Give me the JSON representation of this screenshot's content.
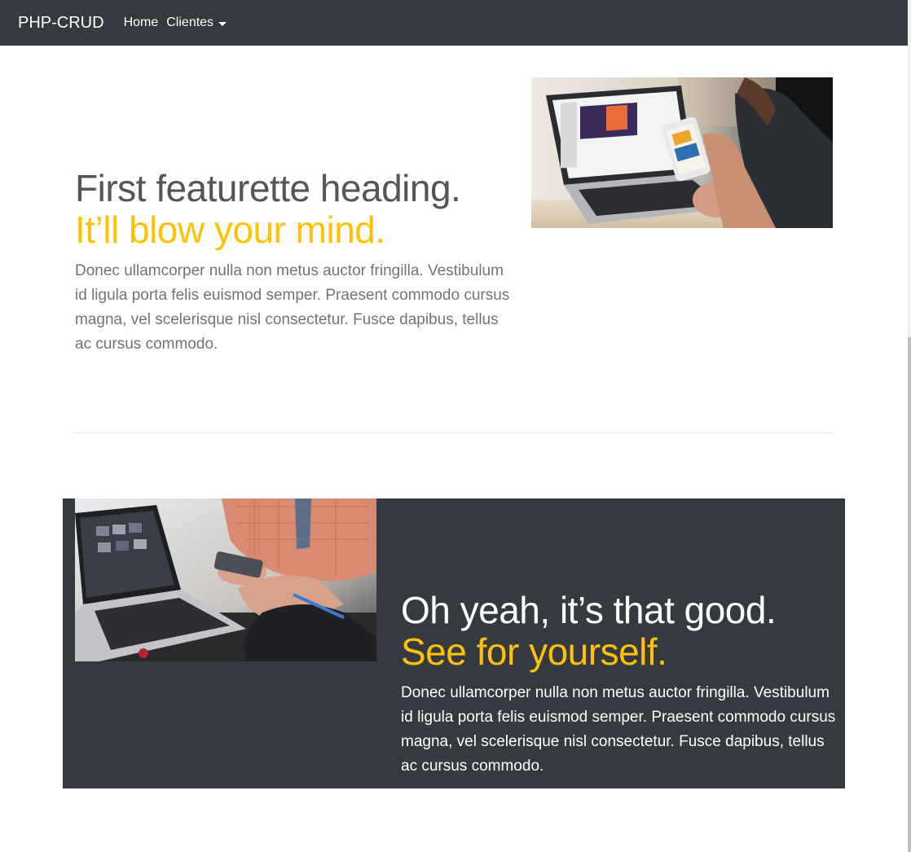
{
  "navbar": {
    "brand": "PHP-CRUD",
    "links": [
      "Home",
      "Clientes"
    ]
  },
  "featurette1": {
    "heading": "First featurette heading.",
    "accent": "It’ll blow your mind.",
    "body": "Donec ullamcorper nulla non metus auctor fringilla. Vestibulum id ligula porta felis euismod semper. Praesent commodo cursus magna, vel scelerisque nisl consectetur. Fusce dapibus, tellus ac cursus commodo."
  },
  "featurette2": {
    "heading": "Oh yeah, it’s that good.",
    "accent": "See for yourself.",
    "body": "Donec ullamcorper nulla non metus auctor fringilla. Vestibulum id ligula porta felis euismod semper. Praesent commodo cursus magna, vel scelerisque nisl consectetur. Fusce dapibus, tellus ac cursus commodo."
  },
  "colors": {
    "navbar_bg": "#343a40",
    "accent": "#ffc107",
    "heading_dark": "#555555",
    "text_muted": "#6c757d"
  },
  "icons": {
    "dropdown": "caret-down-icon"
  }
}
